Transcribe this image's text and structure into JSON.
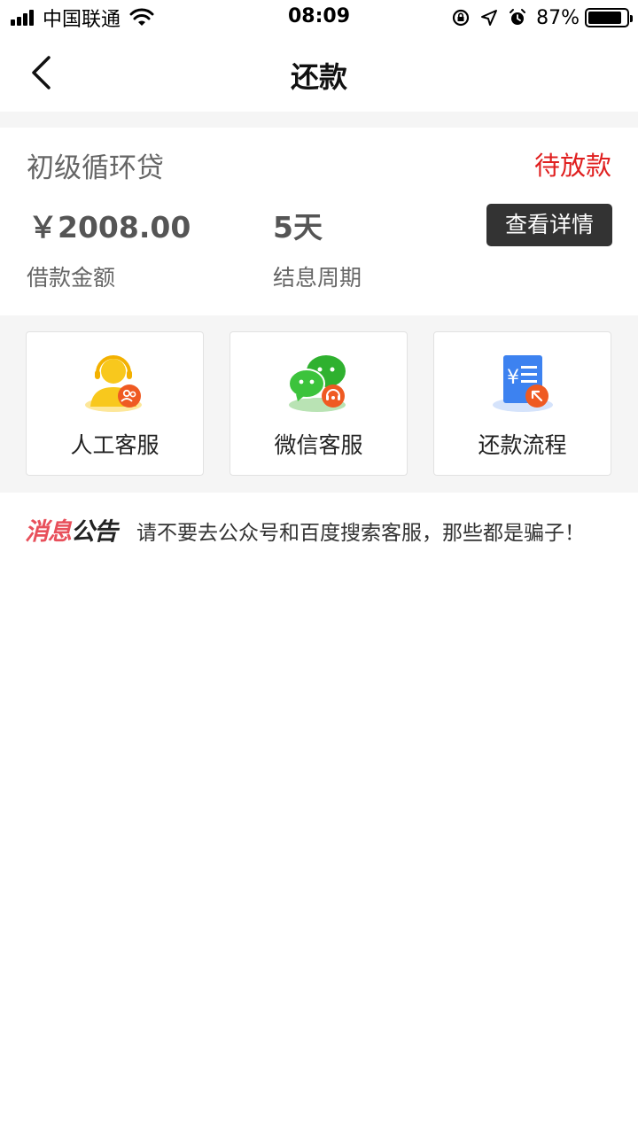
{
  "status_bar": {
    "carrier": "中国联通",
    "time": "08:09",
    "battery_percent": "87%",
    "battery_level": 0.87
  },
  "nav": {
    "title": "还款",
    "back_icon": "chevron-left-icon"
  },
  "loan": {
    "name": "初级循环贷",
    "status": "待放款",
    "status_color": "#e02020",
    "amount": "￥2008.00",
    "amount_label": "借款金额",
    "period": "5天",
    "period_label": "结息周期",
    "detail_button": "查看详情"
  },
  "services": [
    {
      "label": "人工客服",
      "icon": "customer-service-agent-icon"
    },
    {
      "label": "微信客服",
      "icon": "wechat-icon"
    },
    {
      "label": "还款流程",
      "icon": "repayment-document-icon"
    }
  ],
  "notice": {
    "tag_part1": "消息",
    "tag_part2": "公告",
    "text": "请不要去公众号和百度搜索客服，那些都是骗子！"
  }
}
